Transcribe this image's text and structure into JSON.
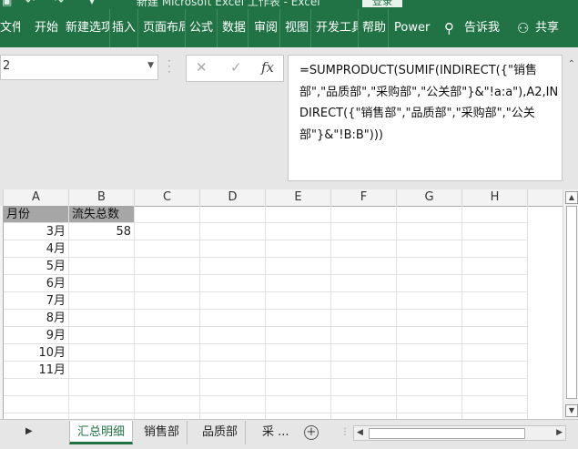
{
  "window": {
    "title": "新建 Microsoft Excel 工作表 - Excel",
    "login_label": "登录"
  },
  "ribbon": {
    "tabs": [
      "文件",
      "开始",
      "新建选项卡",
      "插入",
      "页面布局",
      "公式",
      "数据",
      "审阅",
      "视图",
      "开发工具",
      "帮助",
      "Power"
    ],
    "tell_me": "告诉我",
    "share": "共享"
  },
  "formula_bar": {
    "name_box": "2",
    "fx_label": "fx",
    "formula": "=SUMPRODUCT(SUMIF(INDIRECT({\"销售部\",\"品质部\",\"采购部\",\"公关部\"}&\"!a:a\"),A2,INDIRECT({\"销售部\",\"品质部\",\"采购部\",\"公关部\"}&\"!B:B\")))"
  },
  "grid": {
    "columns": [
      "A",
      "B",
      "C",
      "D",
      "E",
      "F",
      "G",
      "H"
    ],
    "header_row": [
      "月份",
      "流失总数"
    ],
    "rows": [
      [
        "3月",
        "58"
      ],
      [
        "4月",
        ""
      ],
      [
        "5月",
        ""
      ],
      [
        "6月",
        ""
      ],
      [
        "7月",
        ""
      ],
      [
        "8月",
        ""
      ],
      [
        "9月",
        ""
      ],
      [
        "10月",
        ""
      ],
      [
        "11月",
        ""
      ]
    ]
  },
  "sheets": {
    "tabs": [
      "汇总明细",
      "销售部",
      "品质部",
      "采 ..."
    ],
    "active": 0
  },
  "colors": {
    "accent": "#217346",
    "header_fill": "#a6a6a6"
  }
}
